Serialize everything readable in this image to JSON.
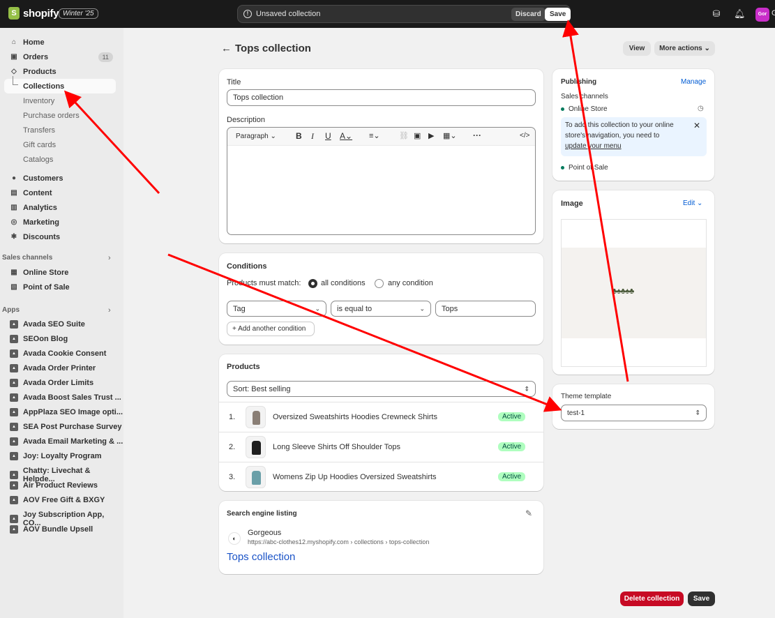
{
  "topbar": {
    "logo_text": "shopify",
    "edition": "Winter '25",
    "unsaved_label": "Unsaved collection",
    "discard_label": "Discard",
    "save_label": "Save",
    "avatar_initials": "Gor",
    "avatar_overflow": "G"
  },
  "sidebar": {
    "main": [
      {
        "label": "Home",
        "icon": "home-icon"
      },
      {
        "label": "Orders",
        "icon": "inbox-icon",
        "count": "11"
      },
      {
        "label": "Products",
        "icon": "tag-icon"
      }
    ],
    "products_sub": [
      "Collections",
      "Inventory",
      "Purchase orders",
      "Transfers",
      "Gift cards",
      "Catalogs"
    ],
    "main2": [
      {
        "label": "Customers",
        "icon": "person-icon"
      },
      {
        "label": "Content",
        "icon": "content-icon"
      },
      {
        "label": "Analytics",
        "icon": "chart-icon"
      },
      {
        "label": "Marketing",
        "icon": "target-icon"
      },
      {
        "label": "Discounts",
        "icon": "discount-icon"
      }
    ],
    "sales_channels_heading": "Sales channels",
    "sales_channels": [
      {
        "label": "Online Store",
        "icon": "store-icon"
      },
      {
        "label": "Point of Sale",
        "icon": "pos-icon"
      }
    ],
    "apps_heading": "Apps",
    "apps": [
      "Avada SEO Suite",
      "SEOon Blog",
      "Avada Cookie Consent",
      "Avada Order Printer",
      "Avada Order Limits",
      "Avada Boost Sales Trust ...",
      "AppPlaza SEO Image opti...",
      "SEA Post Purchase Survey",
      "Avada Email Marketing & ...",
      "Joy: Loyalty Program",
      "Chatty: Livechat & Helpde...",
      "Air Product Reviews",
      "AOV Free Gift & BXGY",
      "Joy Subscription App, CO...",
      "AOV Bundle Upsell"
    ]
  },
  "page": {
    "title": "Tops collection",
    "view_label": "View",
    "more_actions_label": "More actions"
  },
  "title_card": {
    "title_label": "Title",
    "title_value": "Tops collection",
    "description_label": "Description",
    "paragraph_label": "Paragraph"
  },
  "conditions": {
    "heading": "Conditions",
    "must_match_label": "Products must match:",
    "all_label": "all conditions",
    "any_label": "any condition",
    "field_value": "Tag",
    "operator_value": "is equal to",
    "condition_value": "Tops",
    "add_condition_label": "Add another condition"
  },
  "products": {
    "heading": "Products",
    "sort_label": "Sort: Best selling",
    "items": [
      {
        "index": "1.",
        "name": "Oversized Sweatshirts Hoodies Crewneck Shirts",
        "status": "Active"
      },
      {
        "index": "2.",
        "name": "Long Sleeve Shirts Off Shoulder Tops",
        "status": "Active"
      },
      {
        "index": "3.",
        "name": "Womens Zip Up Hoodies Oversized Sweatshirts",
        "status": "Active"
      }
    ]
  },
  "seo": {
    "heading": "Search engine listing",
    "store_name": "Gorgeous",
    "url": "https://abc-clothes12.myshopify.com › collections › tops-collection",
    "title": "Tops collection"
  },
  "publishing": {
    "heading": "Publishing",
    "manage_label": "Manage",
    "channels_label": "Sales channels",
    "online_store": "Online Store",
    "notice_line1": "To add this collection to your online",
    "notice_line2": "store's navigation, you need to",
    "notice_link": "update your menu",
    "pos": "Point of Sale"
  },
  "image_card": {
    "heading": "Image",
    "edit_label": "Edit"
  },
  "theme": {
    "heading": "Theme template",
    "value": "test-1"
  },
  "footer": {
    "delete_label": "Delete collection",
    "save_label": "Save"
  },
  "colors": {
    "accent_link": "#005bd3",
    "active_badge": "#affebf",
    "delete_button": "#c70a24",
    "annotation_arrow": "#ff0000"
  }
}
